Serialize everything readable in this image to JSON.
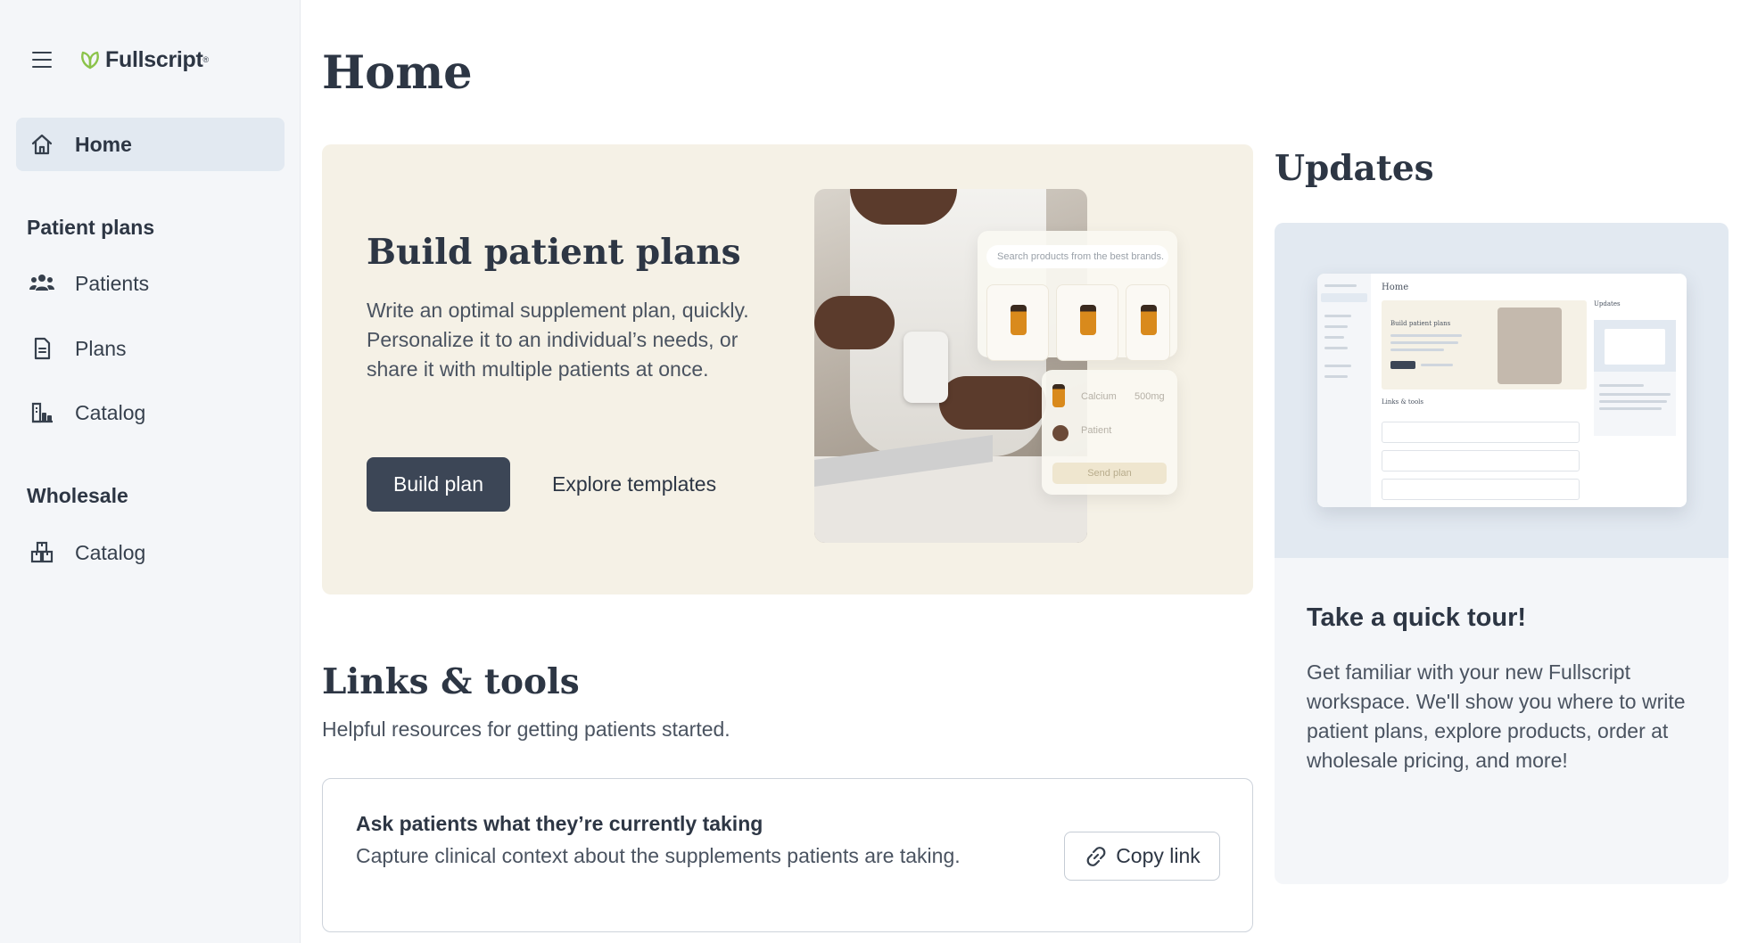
{
  "brand": {
    "name": "Fullscript",
    "accent": "#8bc34a"
  },
  "sidebar": {
    "home": "Home",
    "patient_plans_heading": "Patient plans",
    "patients": "Patients",
    "plans": "Plans",
    "catalog": "Catalog",
    "wholesale_heading": "Wholesale",
    "wholesale_catalog": "Catalog"
  },
  "main": {
    "title": "Home",
    "hero": {
      "title": "Build patient plans",
      "description": "Write an optimal supplement plan, quickly. Personalize it to an individual’s needs, or share it with multiple patients at once.",
      "primary_button": "Build plan",
      "secondary_button": "Explore templates",
      "image": {
        "search_placeholder": "Search products from the best brands.",
        "calcium": "Calcium",
        "dose": "500mg",
        "patient": "Patient",
        "send_plan": "Send plan"
      }
    },
    "links_tools": {
      "title": "Links & tools",
      "subtitle": "Helpful resources for getting patients started.",
      "items": [
        {
          "title": "Ask patients what they’re currently taking",
          "description": "Capture clinical context about the supplements patients are taking.",
          "action": "Copy link"
        }
      ]
    }
  },
  "updates": {
    "title": "Updates",
    "card": {
      "title": "Take a quick tour!",
      "description": "Get familiar with your new Fullscript workspace. We'll show you where to write patient plans, explore products, order at wholesale pricing, and more!",
      "preview": {
        "home": "Home",
        "hero_title": "Build patient plans",
        "links_title": "Links & tools",
        "updates_title": "Updates"
      }
    }
  },
  "colors": {
    "sidebar_bg": "#f4f6f9",
    "active_bg": "#e2e9f1",
    "hero_bg": "#f5f1e6",
    "primary_button": "#3c4656"
  }
}
